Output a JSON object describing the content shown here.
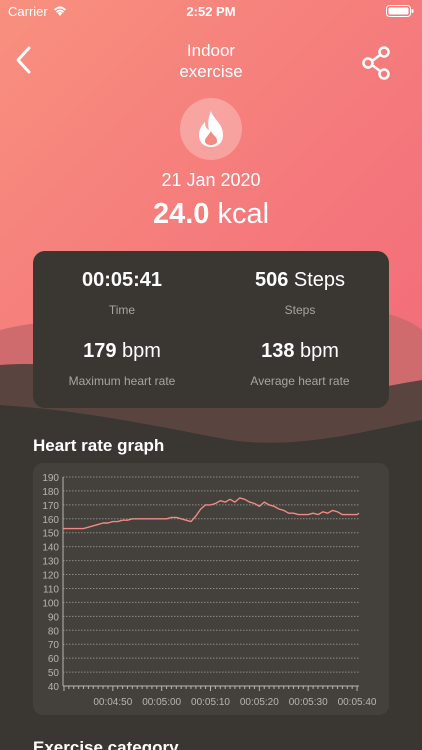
{
  "status": {
    "carrier": "Carrier",
    "time": "2:52 PM"
  },
  "header": {
    "title_line1": "Indoor",
    "title_line2": "exercise"
  },
  "summary": {
    "date": "21 Jan 2020",
    "kcal_value": "24.0",
    "kcal_unit": "kcal"
  },
  "stats": [
    {
      "value": "00:05:41",
      "unit": "",
      "label": "Time"
    },
    {
      "value": "506",
      "unit": "Steps",
      "label": "Steps"
    },
    {
      "value": "179",
      "unit": "bpm",
      "label": "Maximum heart rate"
    },
    {
      "value": "138",
      "unit": "bpm",
      "label": "Average heart rate"
    }
  ],
  "graph_title": "Heart rate graph",
  "next_section_title": "Exercise category",
  "colors": {
    "accent": "#f57b7c",
    "panel": "#3a3632",
    "line": "#f08a86"
  },
  "chart_data": {
    "type": "line",
    "title": "Heart rate graph",
    "xlabel": "",
    "ylabel": "",
    "ylim": [
      40,
      190
    ],
    "yticks": [
      190,
      180,
      170,
      160,
      150,
      140,
      130,
      120,
      110,
      100,
      90,
      80,
      70,
      60,
      50,
      40
    ],
    "xlim": [
      0,
      341
    ],
    "xticks": [
      {
        "x": 50,
        "label": "00:04:50"
      },
      {
        "x": 60,
        "label": "00:05:00"
      },
      {
        "x": 70,
        "label": "00:05:10"
      },
      {
        "x": 80,
        "label": "00:05:20"
      },
      {
        "x": 90,
        "label": "00:05:30"
      },
      {
        "x": 100,
        "label": "00:05:40"
      }
    ],
    "x_start": 39.8,
    "x_end": 100.4,
    "series": [
      {
        "x": [
          39.8,
          41,
          43,
          44,
          45,
          46,
          47,
          48,
          49,
          50,
          51,
          52,
          53,
          54,
          55,
          56,
          57,
          58,
          59,
          60,
          61,
          62,
          63,
          64,
          65,
          66,
          67,
          68,
          69,
          70,
          71,
          72,
          73,
          74,
          75,
          76,
          77,
          78,
          79,
          80,
          81,
          82,
          83,
          84,
          85,
          86,
          87,
          88,
          89,
          90,
          91,
          92,
          93,
          94,
          95,
          96,
          97,
          98,
          99,
          100,
          100.4
        ],
        "values": [
          153,
          153,
          153,
          153,
          154,
          155,
          156,
          157,
          157,
          158,
          158,
          159,
          159,
          160,
          160,
          160,
          160,
          160,
          160,
          160,
          160,
          161,
          161,
          160,
          159,
          158,
          162,
          167,
          170,
          170,
          171,
          173,
          172,
          174,
          172,
          175,
          174,
          172,
          171,
          169,
          172,
          170,
          169,
          167,
          166,
          164,
          164,
          163,
          163,
          163,
          164,
          163,
          165,
          164,
          166,
          165,
          163,
          163,
          163,
          163,
          164
        ]
      }
    ],
    "grid": true
  }
}
